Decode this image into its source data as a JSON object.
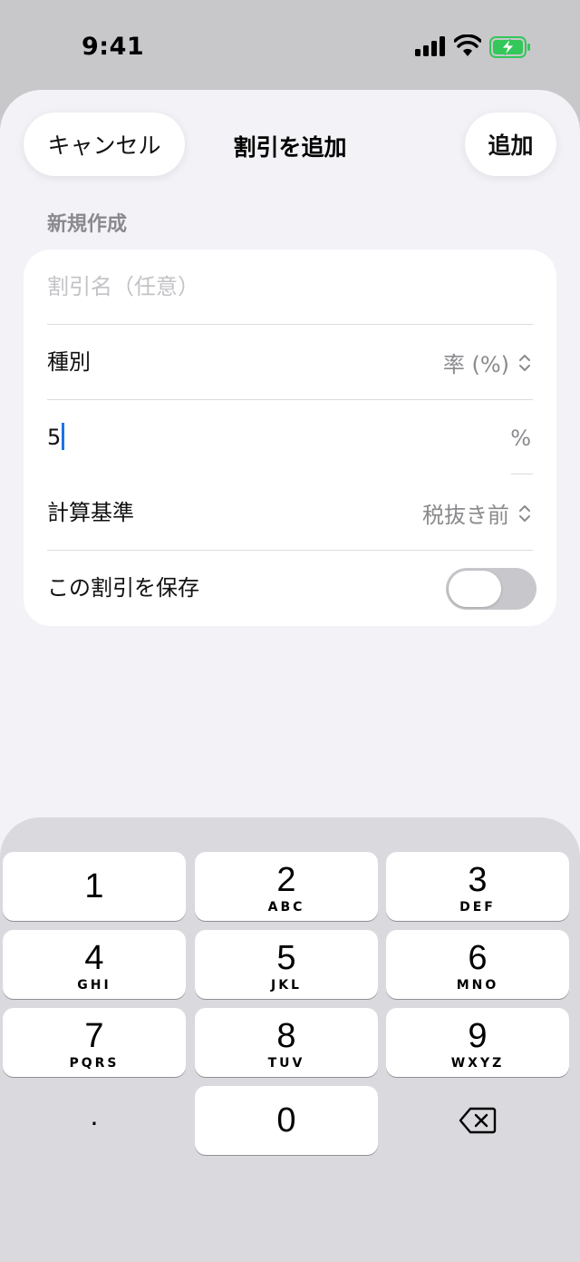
{
  "status_bar": {
    "time": "9:41"
  },
  "nav": {
    "cancel_label": "キャンセル",
    "title": "割引を追加",
    "add_label": "追加"
  },
  "section": {
    "header": "新規作成"
  },
  "form": {
    "name_placeholder": "割引名（任意）",
    "type_label": "種別",
    "type_value": "率 (%)",
    "amount_value": "5",
    "amount_unit": "%",
    "basis_label": "計算基準",
    "basis_value": "税抜き前",
    "save_label": "この割引を保存",
    "save_toggle_on": false
  },
  "keypad": {
    "keys": [
      {
        "digit": "1",
        "letters": ""
      },
      {
        "digit": "2",
        "letters": "ABC"
      },
      {
        "digit": "3",
        "letters": "DEF"
      },
      {
        "digit": "4",
        "letters": "GHI"
      },
      {
        "digit": "5",
        "letters": "JKL"
      },
      {
        "digit": "6",
        "letters": "MNO"
      },
      {
        "digit": "7",
        "letters": "PQRS"
      },
      {
        "digit": "8",
        "letters": "TUV"
      },
      {
        "digit": "9",
        "letters": "WXYZ"
      },
      {
        "digit": "0",
        "letters": ""
      }
    ],
    "decimal": ".",
    "delete_icon": "delete-left-icon"
  },
  "colors": {
    "accent": "#1a73e8",
    "battery_green": "#34c759",
    "sheet_bg": "#f2f2f7"
  }
}
